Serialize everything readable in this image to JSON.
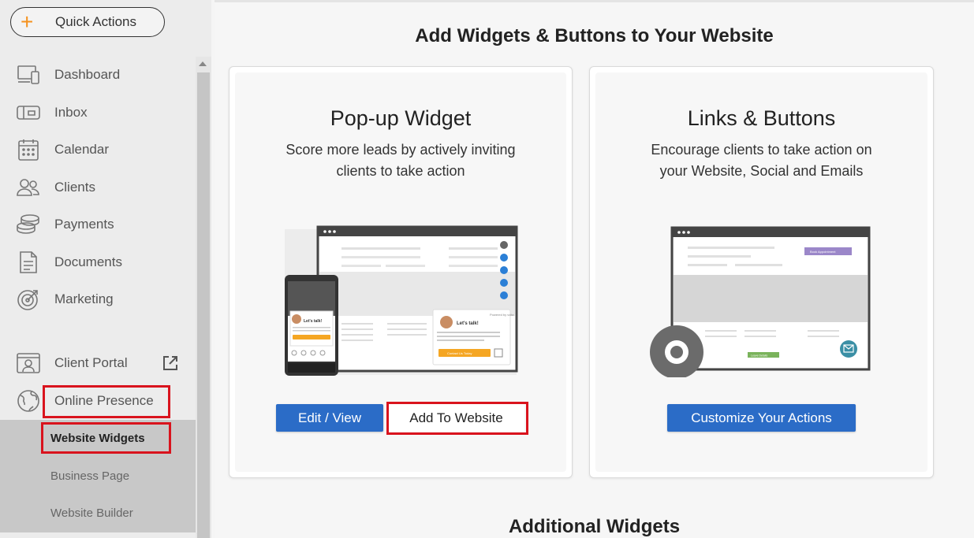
{
  "quick_actions": {
    "label": "Quick Actions",
    "icon": "plus-icon"
  },
  "nav": {
    "items": [
      {
        "label": "Dashboard",
        "icon": "monitor-icon"
      },
      {
        "label": "Inbox",
        "icon": "inbox-icon"
      },
      {
        "label": "Calendar",
        "icon": "calendar-icon"
      },
      {
        "label": "Clients",
        "icon": "users-icon"
      },
      {
        "label": "Payments",
        "icon": "coins-icon"
      },
      {
        "label": "Documents",
        "icon": "document-icon"
      },
      {
        "label": "Marketing",
        "icon": "target-icon"
      },
      {
        "label": "Client Portal",
        "icon": "portal-icon"
      },
      {
        "label": "Online Presence",
        "icon": "globe-icon"
      }
    ],
    "sub_items": [
      {
        "label": "Website Widgets"
      },
      {
        "label": "Business Page"
      },
      {
        "label": "Website Builder"
      }
    ]
  },
  "main": {
    "title": "Add Widgets & Buttons to Your Website",
    "additional_title": "Additional Widgets",
    "cards": [
      {
        "title": "Pop-up Widget",
        "description": "Score more leads by actively inviting clients to take action",
        "buttons": [
          "Edit / View",
          "Add To Website"
        ],
        "illustration": {
          "title": "Let's talk!",
          "body": "No time left to lose, come to submit your contact request!",
          "cta": "Contact Us Today",
          "powered": "Powered by vcita"
        }
      },
      {
        "title": "Links & Buttons",
        "description": "Encourage clients to take action on your Website, Social and Emails",
        "buttons": [
          "Customize Your Actions"
        ],
        "illustration": {
          "book_label": "Book Appointment",
          "leave_label": "Leave Details"
        }
      }
    ]
  },
  "colors": {
    "accent_blue": "#2b6cc7",
    "highlight_red": "#d9131d",
    "plus_orange": "#f5921e"
  }
}
